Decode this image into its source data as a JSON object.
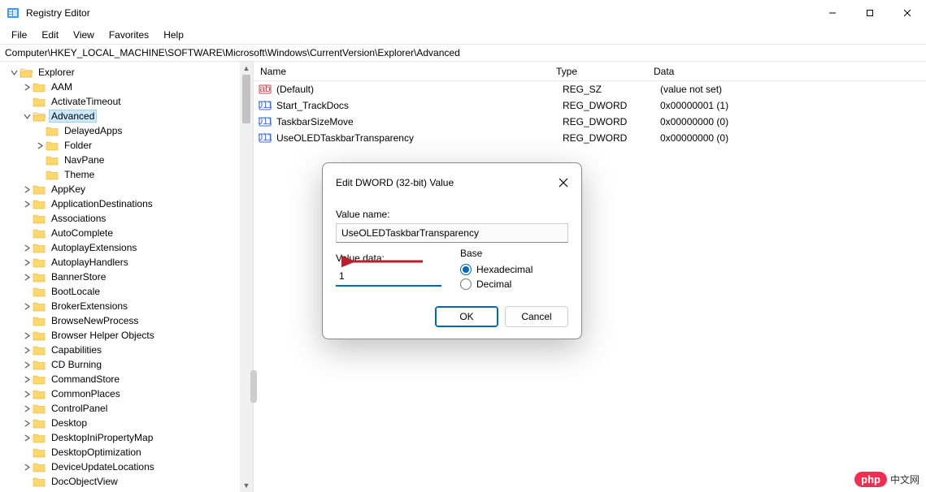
{
  "window": {
    "title": "Registry Editor"
  },
  "menu": {
    "items": [
      "File",
      "Edit",
      "View",
      "Favorites",
      "Help"
    ]
  },
  "path": "Computer\\HKEY_LOCAL_MACHINE\\SOFTWARE\\Microsoft\\Windows\\CurrentVersion\\Explorer\\Advanced",
  "tree": [
    {
      "indent": 5,
      "label": "Explorer",
      "expanded": true,
      "hasChildren": true
    },
    {
      "indent": 6,
      "label": "AAM",
      "expanded": false,
      "hasChildren": true
    },
    {
      "indent": 6,
      "label": "ActivateTimeout",
      "expanded": false,
      "hasChildren": false
    },
    {
      "indent": 6,
      "label": "Advanced",
      "expanded": true,
      "hasChildren": true,
      "selected": true
    },
    {
      "indent": 7,
      "label": "DelayedApps",
      "expanded": false,
      "hasChildren": false
    },
    {
      "indent": 7,
      "label": "Folder",
      "expanded": false,
      "hasChildren": true
    },
    {
      "indent": 7,
      "label": "NavPane",
      "expanded": false,
      "hasChildren": false
    },
    {
      "indent": 7,
      "label": "Theme",
      "expanded": false,
      "hasChildren": false
    },
    {
      "indent": 6,
      "label": "AppKey",
      "expanded": false,
      "hasChildren": true
    },
    {
      "indent": 6,
      "label": "ApplicationDestinations",
      "expanded": false,
      "hasChildren": true
    },
    {
      "indent": 6,
      "label": "Associations",
      "expanded": false,
      "hasChildren": false
    },
    {
      "indent": 6,
      "label": "AutoComplete",
      "expanded": false,
      "hasChildren": false
    },
    {
      "indent": 6,
      "label": "AutoplayExtensions",
      "expanded": false,
      "hasChildren": true
    },
    {
      "indent": 6,
      "label": "AutoplayHandlers",
      "expanded": false,
      "hasChildren": true
    },
    {
      "indent": 6,
      "label": "BannerStore",
      "expanded": false,
      "hasChildren": true
    },
    {
      "indent": 6,
      "label": "BootLocale",
      "expanded": false,
      "hasChildren": false
    },
    {
      "indent": 6,
      "label": "BrokerExtensions",
      "expanded": false,
      "hasChildren": true
    },
    {
      "indent": 6,
      "label": "BrowseNewProcess",
      "expanded": false,
      "hasChildren": false
    },
    {
      "indent": 6,
      "label": "Browser Helper Objects",
      "expanded": false,
      "hasChildren": true
    },
    {
      "indent": 6,
      "label": "Capabilities",
      "expanded": false,
      "hasChildren": true
    },
    {
      "indent": 6,
      "label": "CD Burning",
      "expanded": false,
      "hasChildren": true
    },
    {
      "indent": 6,
      "label": "CommandStore",
      "expanded": false,
      "hasChildren": true
    },
    {
      "indent": 6,
      "label": "CommonPlaces",
      "expanded": false,
      "hasChildren": true
    },
    {
      "indent": 6,
      "label": "ControlPanel",
      "expanded": false,
      "hasChildren": true
    },
    {
      "indent": 6,
      "label": "Desktop",
      "expanded": false,
      "hasChildren": true
    },
    {
      "indent": 6,
      "label": "DesktopIniPropertyMap",
      "expanded": false,
      "hasChildren": true
    },
    {
      "indent": 6,
      "label": "DesktopOptimization",
      "expanded": false,
      "hasChildren": false
    },
    {
      "indent": 6,
      "label": "DeviceUpdateLocations",
      "expanded": false,
      "hasChildren": true
    },
    {
      "indent": 6,
      "label": "DocObjectView",
      "expanded": false,
      "hasChildren": false
    }
  ],
  "list": {
    "columns": {
      "name": "Name",
      "type": "Type",
      "data": "Data"
    },
    "rows": [
      {
        "icon": "string",
        "name": "(Default)",
        "type": "REG_SZ",
        "data": "(value not set)"
      },
      {
        "icon": "binary",
        "name": "Start_TrackDocs",
        "type": "REG_DWORD",
        "data": "0x00000001 (1)"
      },
      {
        "icon": "binary",
        "name": "TaskbarSizeMove",
        "type": "REG_DWORD",
        "data": "0x00000000 (0)"
      },
      {
        "icon": "binary",
        "name": "UseOLEDTaskbarTransparency",
        "type": "REG_DWORD",
        "data": "0x00000000 (0)"
      }
    ]
  },
  "dialog": {
    "title": "Edit DWORD (32-bit) Value",
    "valueNameLabel": "Value name:",
    "valueName": "UseOLEDTaskbarTransparency",
    "valueDataLabel": "Value data:",
    "valueData": "1",
    "baseLabel": "Base",
    "hexLabel": "Hexadecimal",
    "decLabel": "Decimal",
    "base": "hex",
    "okLabel": "OK",
    "cancelLabel": "Cancel"
  },
  "watermark": {
    "badge": "php",
    "text": "中文网"
  }
}
